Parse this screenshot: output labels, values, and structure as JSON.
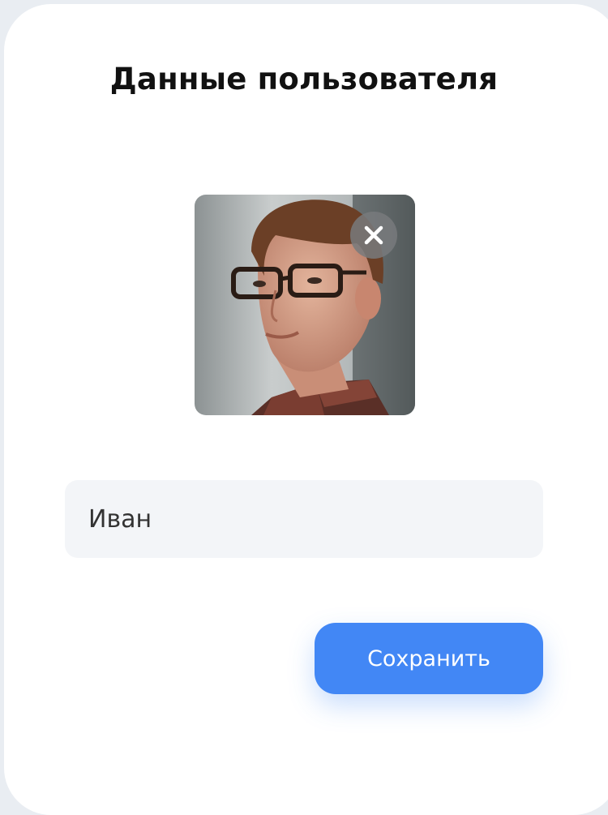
{
  "dialog": {
    "title": "Данные пользователя"
  },
  "avatar": {
    "icon": "user-photo",
    "remove_icon": "close-icon"
  },
  "form": {
    "name_value": "Иван",
    "name_placeholder": ""
  },
  "actions": {
    "save_label": "Сохранить"
  },
  "colors": {
    "accent": "#4287f5",
    "field_background": "#f3f5f8",
    "page_background": "#e9edf2",
    "remove_button": "#787a7d"
  }
}
